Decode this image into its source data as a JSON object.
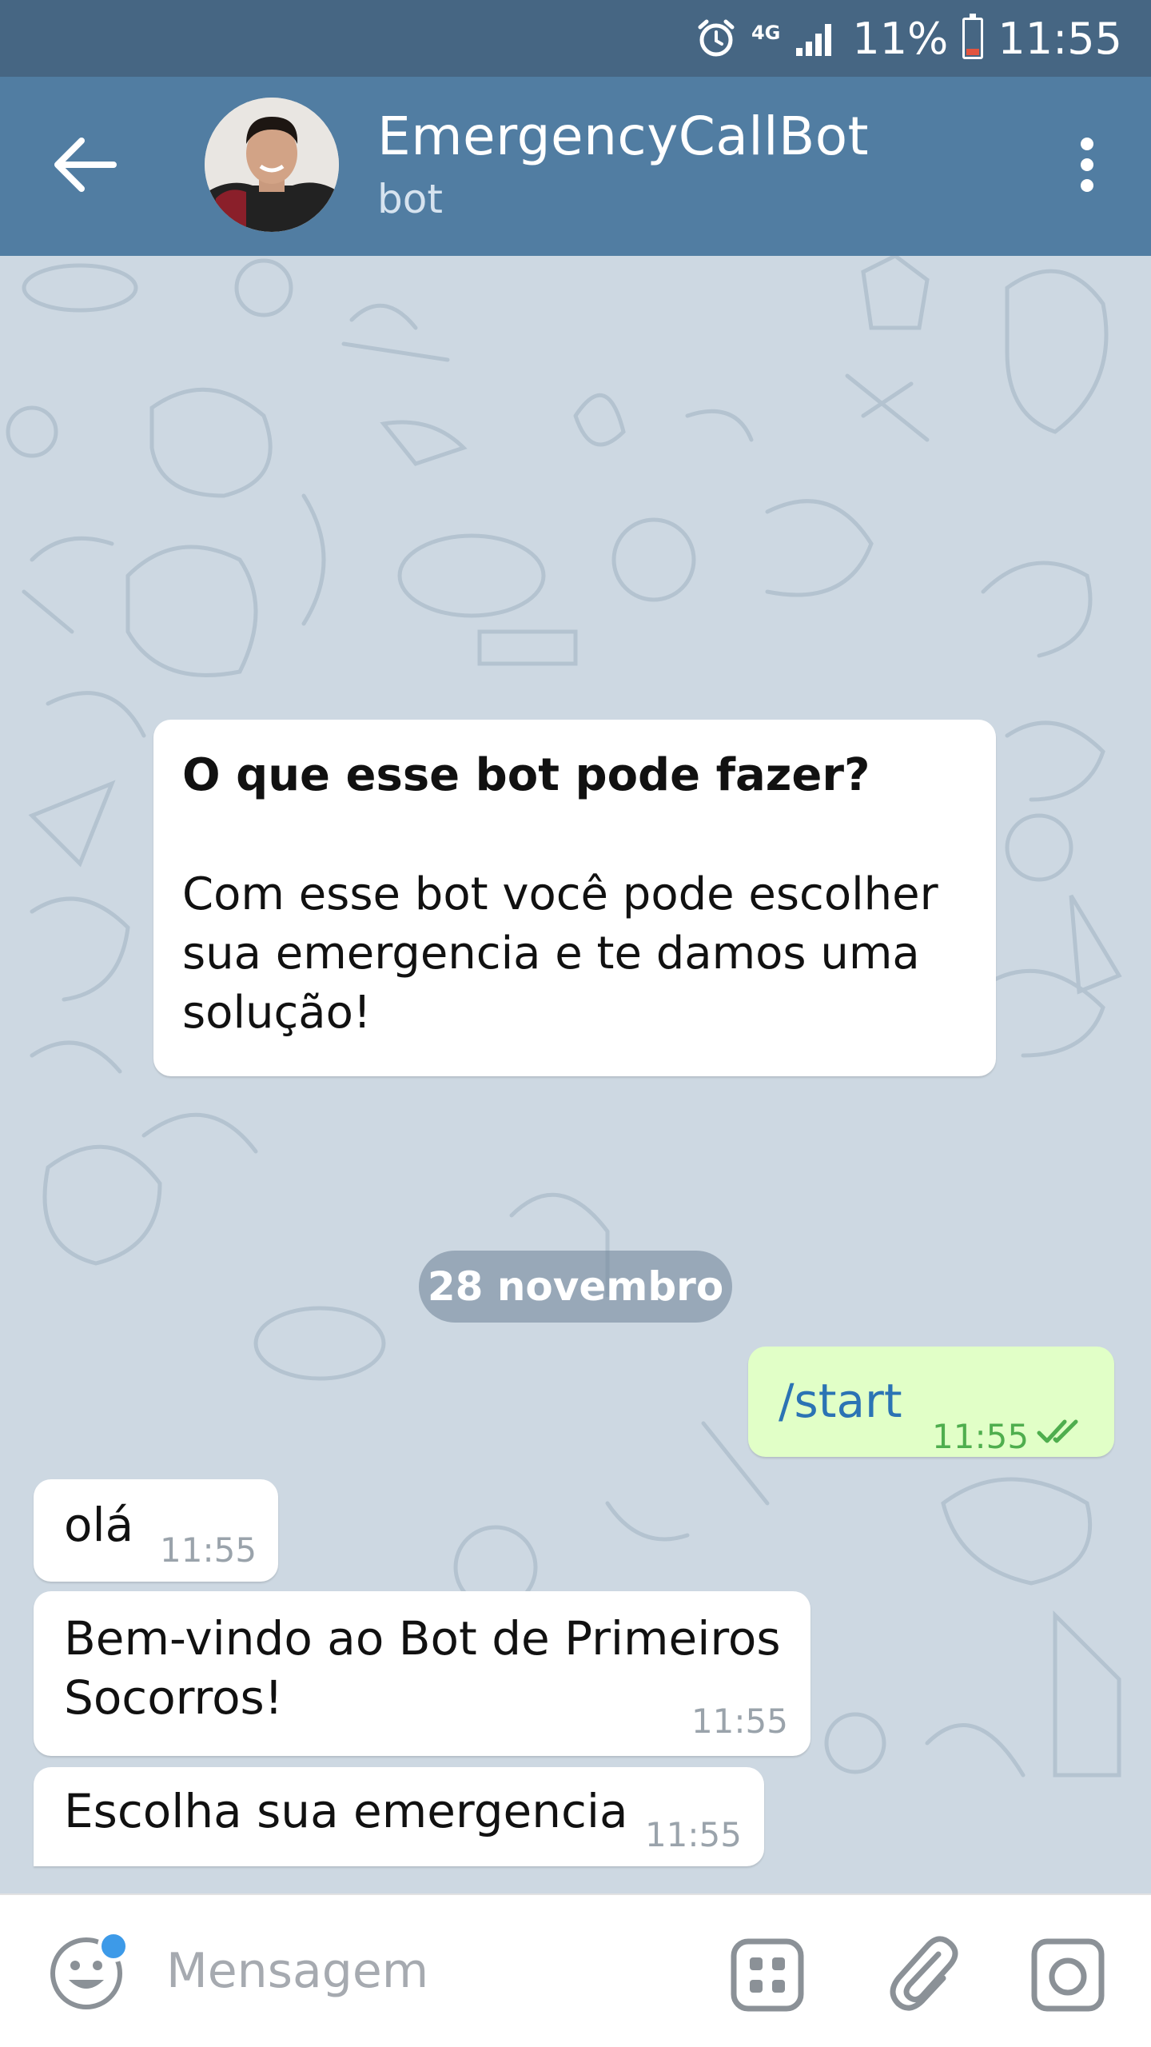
{
  "status_bar": {
    "network": "4G",
    "battery": "11%",
    "time": "11:55",
    "icons": [
      "alarm-icon",
      "signal-icon",
      "battery-icon"
    ]
  },
  "header": {
    "title": "EmergencyCallBot",
    "subtitle": "bot",
    "back_icon": "arrow-left-icon",
    "menu_icon": "more-vertical-icon"
  },
  "chat": {
    "info_card": {
      "title": "O que esse bot pode fazer?",
      "text": "Com esse bot você pode escolher sua emergencia e te damos uma solução!"
    },
    "date": "28 novembro",
    "messages": [
      {
        "direction": "out",
        "text": "/start",
        "time": "11:55",
        "status": "read"
      },
      {
        "direction": "in",
        "text": "olá",
        "time": "11:55"
      },
      {
        "direction": "in",
        "text": "Bem-vindo ao Bot de Primeiros Socorros!",
        "time": "11:55"
      },
      {
        "direction": "in",
        "text": "Escolha sua emergencia",
        "time": "11:55"
      }
    ]
  },
  "input_bar": {
    "placeholder": "Mensagem"
  },
  "colors": {
    "header": "#517da2",
    "status_bar": "#466683",
    "outgoing_bubble": "#e1ffc7",
    "command_link": "#2b73b4",
    "read_checks": "#4fae4e"
  }
}
